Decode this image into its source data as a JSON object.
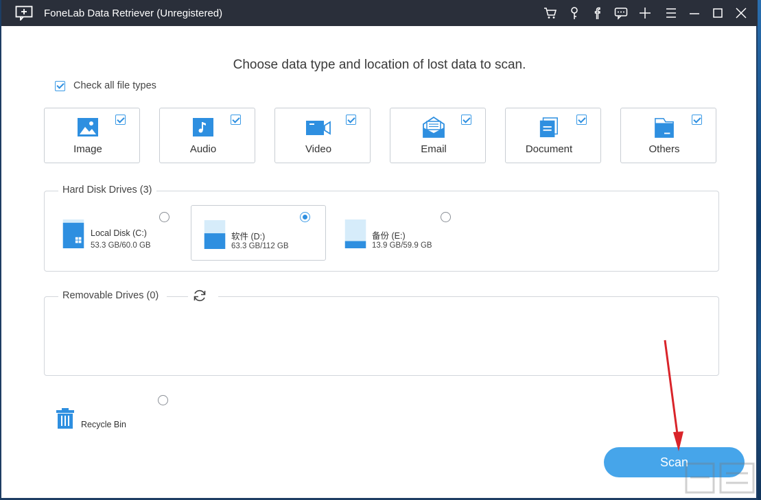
{
  "window": {
    "title": "FoneLab Data Retriever (Unregistered)",
    "toolbar_icons": [
      "cart-icon",
      "key-icon",
      "facebook-icon",
      "chat-icon",
      "plus-icon",
      "menu-icon",
      "minimize-icon",
      "maximize-icon",
      "close-icon"
    ]
  },
  "main": {
    "heading": "Choose data type and location of lost data to scan.",
    "check_all": {
      "label": "Check all file types",
      "checked": true
    }
  },
  "file_types": [
    {
      "label": "Image",
      "icon": "image-icon",
      "checked": true
    },
    {
      "label": "Audio",
      "icon": "audio-icon",
      "checked": true
    },
    {
      "label": "Video",
      "icon": "video-icon",
      "checked": true
    },
    {
      "label": "Email",
      "icon": "email-icon",
      "checked": true
    },
    {
      "label": "Document",
      "icon": "document-icon",
      "checked": true
    },
    {
      "label": "Others",
      "icon": "folder-icon",
      "checked": true
    }
  ],
  "hard_disks": {
    "title": "Hard Disk Drives (3)",
    "drives": [
      {
        "name": "Local Disk (C:)",
        "size": "53.3 GB/60.0 GB",
        "selected": false,
        "icon": "windows-drive-icon"
      },
      {
        "name": "软件 (D:)",
        "size": "63.3 GB/112 GB",
        "selected": true,
        "icon": "drive-icon"
      },
      {
        "name": "备份 (E:)",
        "size": "13.9 GB/59.9 GB",
        "selected": false,
        "icon": "drive-icon"
      }
    ]
  },
  "removable": {
    "title": "Removable Drives (0)"
  },
  "recycle_bin": {
    "label": "Recycle Bin",
    "selected": false
  },
  "scan_button": {
    "label": "Scan"
  },
  "colors": {
    "accent": "#2e8fe0",
    "button": "#46a5ea",
    "titlebar": "#2a2f3a",
    "arrow": "#d9242a"
  }
}
